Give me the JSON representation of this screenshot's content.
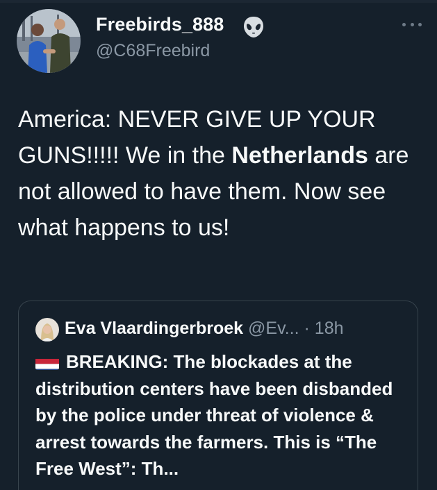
{
  "tweet": {
    "display_name": "Freebirds_888",
    "handle": "@C68Freebird",
    "text_part1": "America: NEVER GIVE UP YOUR GUNS!!!!! We in the ",
    "text_bold": "Netherlands",
    "text_part2": " are not allowed to have them. Now see what happens to us!"
  },
  "quote": {
    "display_name": "Eva Vlaardingerbroek",
    "handle": "@Ev...",
    "time": "· 18h",
    "text": "BREAKING: The blockades at the distribution centers have been disbanded by the police under threat of violence & arrest towards the farmers. This is “The Free West”: Th..."
  },
  "icons": {
    "badge": "alien-emoji-icon",
    "more": "more-options-icon",
    "flag": "netherlands-flag-icon"
  },
  "colors": {
    "background": "#15202b",
    "text": "#f7f9f9",
    "secondary_text": "#8b98a5",
    "border": "#38444d"
  }
}
